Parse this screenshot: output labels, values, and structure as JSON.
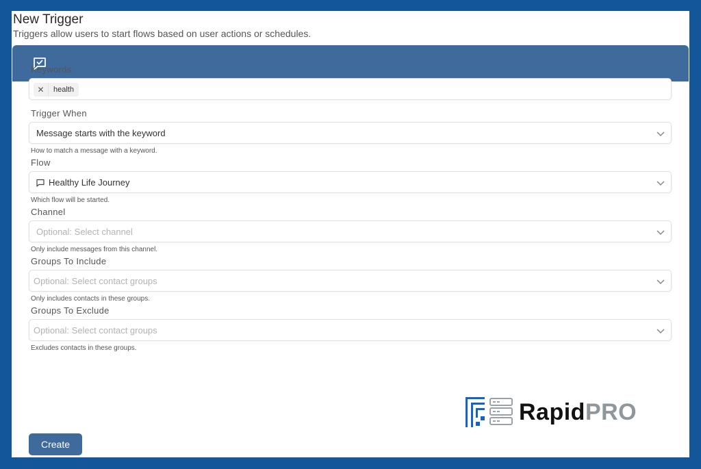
{
  "header": {
    "title": "New Trigger",
    "subtitle": "Triggers allow users to start flows based on user actions or schedules."
  },
  "card_icon": "message-check-icon",
  "form": {
    "keywords": {
      "label": "Keywords",
      "tags": [
        "health"
      ]
    },
    "trigger_when": {
      "label": "Trigger When",
      "value": "Message starts with the keyword",
      "help": "How to match a message with a keyword."
    },
    "flow": {
      "label": "Flow",
      "value": "Healthy Life Journey",
      "icon": "message-icon",
      "help": "Which flow will be started."
    },
    "channel": {
      "label": "Channel",
      "placeholder": "Optional: Select channel",
      "help": "Only include messages from this channel."
    },
    "groups_include": {
      "label": "Groups To Include",
      "placeholder": "Optional: Select contact groups",
      "help": "Only includes contacts in these groups."
    },
    "groups_exclude": {
      "label": "Groups To Exclude",
      "placeholder": "Optional: Select contact groups",
      "help": "Excludes contacts in these groups."
    }
  },
  "actions": {
    "create_label": "Create"
  },
  "brand": {
    "part1": "Rapid",
    "part2": "PRO",
    "logo": "server-stack-logo"
  },
  "colors": {
    "background": "#13579a",
    "accent": "#3e6b9c",
    "brand_gray": "#8f969c"
  }
}
